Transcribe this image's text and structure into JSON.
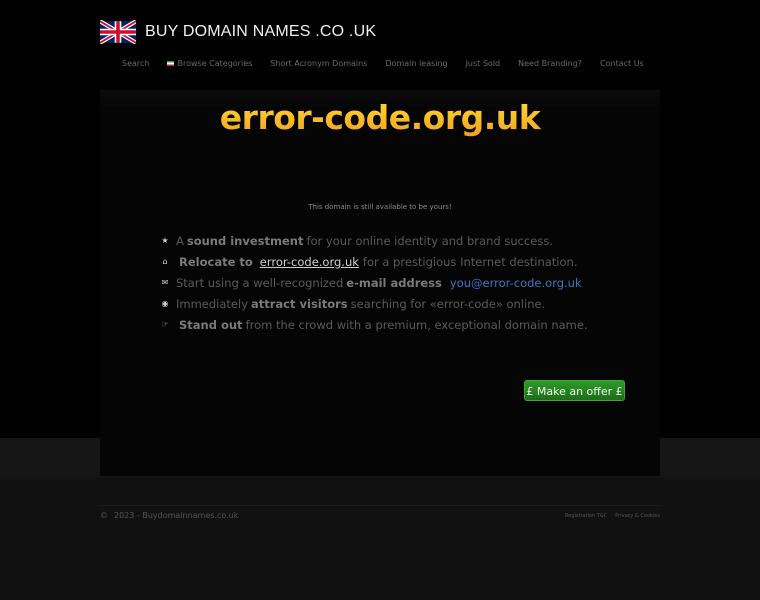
{
  "header": {
    "site_title": "BUY DOMAIN NAMES .CO .UK",
    "flag_icon": "uk-flag-icon"
  },
  "nav": {
    "items": [
      {
        "label": "Search"
      },
      {
        "label": "Browse Categories",
        "icon": "uk-mini-flag-icon"
      },
      {
        "label": "Short Acronym Domains"
      },
      {
        "label": "Domain leasing"
      },
      {
        "label": "Just Sold"
      },
      {
        "label": "Need Branding?"
      },
      {
        "label": "Contact Us"
      }
    ]
  },
  "main": {
    "domain": "error-code.org.uk",
    "availability_text": "This domain is still available to be yours!",
    "features": [
      {
        "icon": "star-icon",
        "pre": "A",
        "bold": "sound investment",
        "post": "for your online identity and brand success."
      },
      {
        "icon": "home-icon",
        "bold": "Relocate to",
        "link": "error-code.org.uk",
        "post": "for a prestigious Internet destination."
      },
      {
        "icon": "envelope-icon",
        "pre": "Start using a well-recognized",
        "bold": "e-mail address",
        "email": "you@error-code.org.uk"
      },
      {
        "icon": "eye-icon",
        "pre": "Immediately",
        "bold": "attract visitors",
        "post": "searching for «error-code» online."
      },
      {
        "icon": "hand-pointer-icon",
        "bold": "Stand out",
        "post": "from the crowd with a premium, exceptional domain name."
      }
    ],
    "offer_button_label": "£ Make an offer £"
  },
  "footer": {
    "copyright": "2023 - Buydomainnames.co.uk",
    "copy_symbol": "©",
    "links": [
      "Registration T&C",
      "Privacy & Cookies"
    ]
  },
  "colors": {
    "accent_green": "#2f9a28",
    "title_gold": "#f0a020",
    "email_blue": "#3a78c0"
  }
}
